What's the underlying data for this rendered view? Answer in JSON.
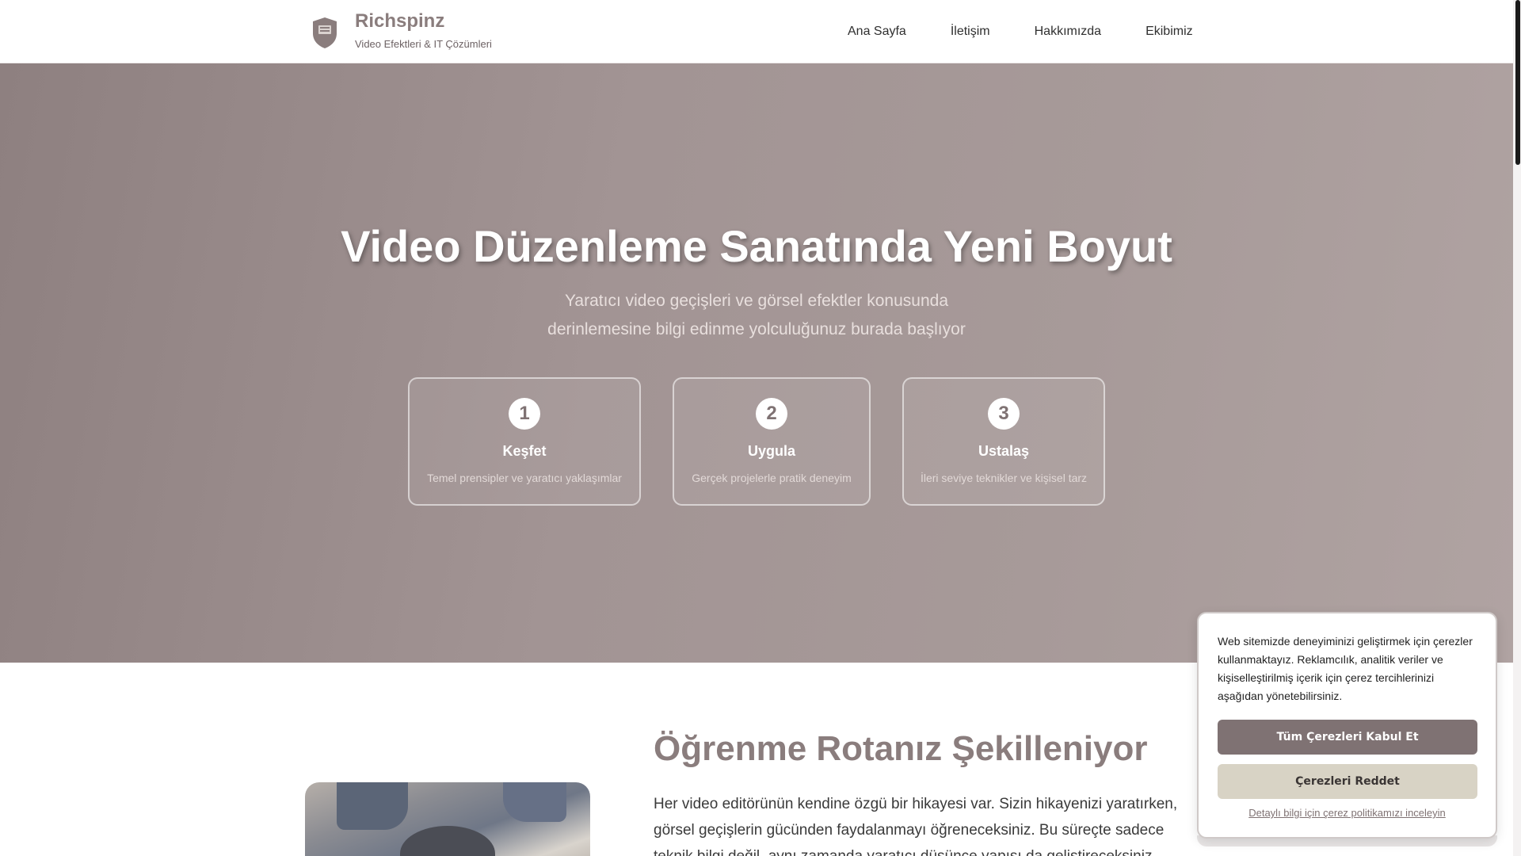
{
  "header": {
    "brand_name": "Richspinz",
    "brand_tagline": "Video Efektleri & IT Çözümleri",
    "logo_icon": "shield-icon",
    "nav": [
      {
        "label": "Ana Sayfa"
      },
      {
        "label": "İletişim"
      },
      {
        "label": "Hakkımızda"
      },
      {
        "label": "Ekibimiz"
      }
    ]
  },
  "hero": {
    "title": "Video Düzenleme Sanatında Yeni Boyut",
    "subtitle_line1": "Yaratıcı video geçişleri ve görsel efektler konusunda",
    "subtitle_line2": "derinlemesine bilgi edinme yolculuğunuz burada başlıyor",
    "steps": [
      {
        "number": "1",
        "title": "Keşfet",
        "desc": "Temel prensipler ve yaratıcı yaklaşımlar"
      },
      {
        "number": "2",
        "title": "Uygula",
        "desc": "Gerçek projelerle pratik deneyim"
      },
      {
        "number": "3",
        "title": "Ustalaş",
        "desc": "İleri seviye teknikler ve kişisel tarz"
      }
    ]
  },
  "learning": {
    "title": "Öğrenme Rotanız Şekilleniyor",
    "text": "Her video editörünün kendine özgü bir hikayesi var. Sizin hikayenizi yaratırken, görsel geçişlerin gücünden faydalanmayı öğreneceksiniz. Bu süreçte sadece teknik bilgi değil, aynı zamanda yaratıcı düşünce yapısı da geliştireceksiniz."
  },
  "cookie": {
    "text": "Web sitemizde deneyiminizi geliştirmek için çerezler kullanmaktayız. Reklamcılık, analitik veriler ve kişiselleştirilmiş içerik için çerez tercihlerinizi aşağıdan yönetebilirsiniz.",
    "accept_label": "Tüm Çerezleri Kabul Et",
    "reject_label": "Çerezleri Reddet",
    "policy_link": "Detaylı bilgi için çerez politikamızı inceleyin"
  },
  "colors": {
    "brand": "#8a7d7d",
    "hero_bg": "#a29494",
    "accept_button": "#7f7273",
    "reject_button": "#d8d3c5"
  }
}
